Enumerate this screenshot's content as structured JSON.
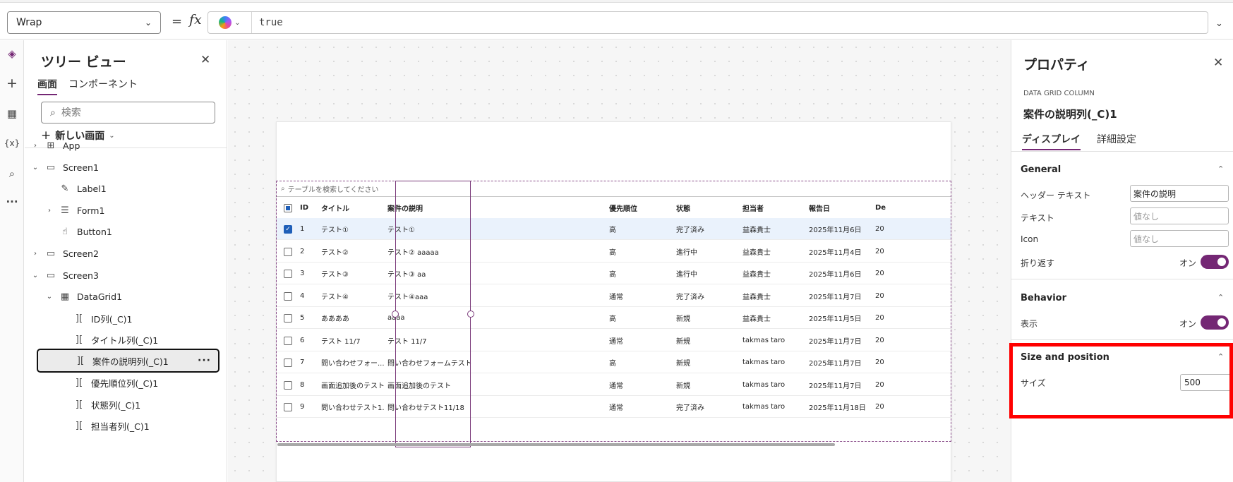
{
  "formula_bar": {
    "property": "Wrap",
    "equals": "=",
    "fx": "fx",
    "formula": "true"
  },
  "rail": {
    "icons": [
      "layers-icon",
      "plus-icon",
      "table-icon",
      "variable-icon",
      "search-icon",
      "more-icon"
    ]
  },
  "tree": {
    "title": "ツリー ビュー",
    "tabs": [
      "画面",
      "コンポーネント"
    ],
    "search_placeholder": "検索",
    "new_screen": "新しい画面",
    "items": [
      {
        "label": "App",
        "icon": "app-icon",
        "expander": "›"
      },
      {
        "label": "Screen1",
        "icon": "screen-icon",
        "expander": "⌄"
      },
      {
        "label": "Label1",
        "icon": "label-icon",
        "expander": ""
      },
      {
        "label": "Form1",
        "icon": "form-icon",
        "expander": "›"
      },
      {
        "label": "Button1",
        "icon": "button-icon",
        "expander": ""
      },
      {
        "label": "Screen2",
        "icon": "screen-icon",
        "expander": "›"
      },
      {
        "label": "Screen3",
        "icon": "screen-icon",
        "expander": "⌄"
      },
      {
        "label": "DataGrid1",
        "icon": "datagrid-icon",
        "expander": "⌄"
      },
      {
        "label": "ID列(_C)1",
        "icon": "column-icon",
        "expander": ""
      },
      {
        "label": "タイトル列(_C)1",
        "icon": "column-icon",
        "expander": ""
      },
      {
        "label": "案件の説明列(_C)1",
        "icon": "column-icon",
        "expander": "",
        "selected": true
      },
      {
        "label": "優先順位列(_C)1",
        "icon": "column-icon",
        "expander": ""
      },
      {
        "label": "状態列(_C)1",
        "icon": "column-icon",
        "expander": ""
      },
      {
        "label": "担当者列(_C)1",
        "icon": "column-icon",
        "expander": ""
      }
    ]
  },
  "grid": {
    "search_placeholder": "テーブルを検索してください",
    "headers": [
      "ID",
      "タイトル",
      "案件の説明",
      "優先順位",
      "状態",
      "担当者",
      "報告日",
      "De"
    ],
    "rows": [
      [
        "1",
        "テスト①",
        "テスト①",
        "高",
        "完了済み",
        "益森貴士",
        "2025年11月6日",
        "20"
      ],
      [
        "2",
        "テスト②",
        "テスト② aaaaa",
        "高",
        "進行中",
        "益森貴士",
        "2025年11月4日",
        "20"
      ],
      [
        "3",
        "テスト③",
        "テスト③ aa",
        "高",
        "進行中",
        "益森貴士",
        "2025年11月6日",
        "20"
      ],
      [
        "4",
        "テスト④",
        "テスト④aaa",
        "通常",
        "完了済み",
        "益森貴士",
        "2025年11月7日",
        "20"
      ],
      [
        "5",
        "ああああ",
        "aaaa",
        "高",
        "新規",
        "益森貴士",
        "2025年11月5日",
        "20"
      ],
      [
        "6",
        "テスト 11/7",
        "テスト 11/7",
        "通常",
        "新規",
        "takmas taro",
        "2025年11月7日",
        "20"
      ],
      [
        "7",
        "問い合わせフォー...",
        "問い合わせフォームテスト",
        "高",
        "新規",
        "takmas taro",
        "2025年11月7日",
        "20"
      ],
      [
        "8",
        "画面追加後のテスト",
        "画面追加後のテスト",
        "通常",
        "新規",
        "takmas taro",
        "2025年11月7日",
        "20"
      ],
      [
        "9",
        "問い合わせテスト1...",
        "問い合わせテスト11/18",
        "通常",
        "完了済み",
        "takmas taro",
        "2025年11月18日",
        "20"
      ]
    ]
  },
  "props": {
    "title": "プロパティ",
    "type": "DATA GRID COLUMN",
    "name": "案件の説明列(_C)1",
    "tabs": [
      "ディスプレイ",
      "詳細設定"
    ],
    "general": {
      "title": "General",
      "header_text_label": "ヘッダー テキスト",
      "header_text_value": "案件の説明",
      "text_label": "テキスト",
      "text_placeholder": "値なし",
      "icon_label": "Icon",
      "icon_placeholder": "値なし",
      "wrap_label": "折り返す",
      "wrap_state": "オン"
    },
    "behavior": {
      "title": "Behavior",
      "visible_label": "表示",
      "visible_state": "オン"
    },
    "size_position": {
      "title": "Size and position",
      "size_label": "サイズ",
      "size_value": "500"
    }
  },
  "colors": {
    "accent": "#742774",
    "highlight": "#ff0000",
    "selection": "#1f5fb8"
  }
}
